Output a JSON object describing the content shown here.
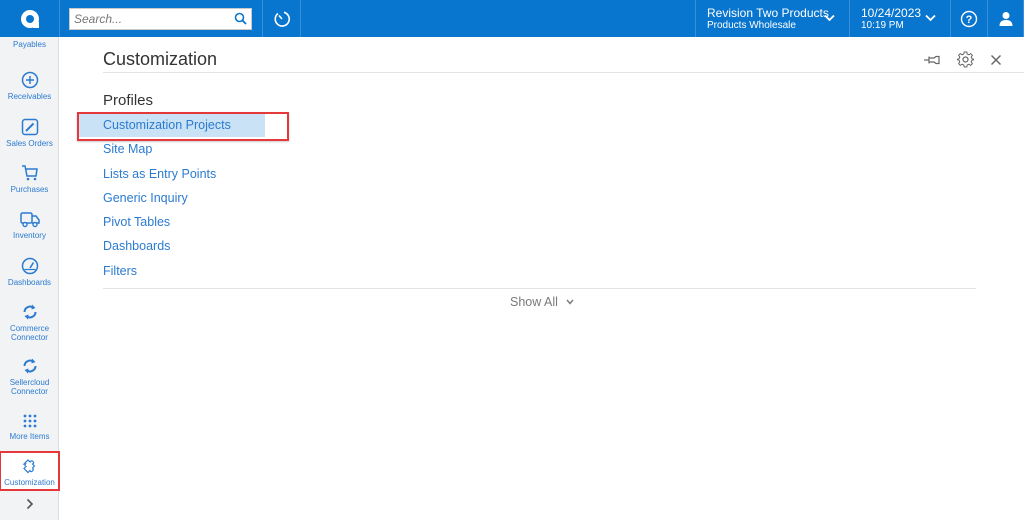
{
  "topbar": {
    "search_placeholder": "Search...",
    "tenant": {
      "name": "Revision Two Products",
      "branch": "Products Wholesale"
    },
    "date": {
      "date": "10/24/2023",
      "time": "10:19 PM"
    }
  },
  "sidebar": {
    "items": [
      {
        "label": "Payables",
        "icon": "payables-icon"
      },
      {
        "label": "Receivables",
        "icon": "plus-circle-icon"
      },
      {
        "label": "Sales Orders",
        "icon": "edit-icon"
      },
      {
        "label": "Purchases",
        "icon": "cart-icon"
      },
      {
        "label": "Inventory",
        "icon": "truck-icon"
      },
      {
        "label": "Dashboards",
        "icon": "gauge-icon"
      },
      {
        "label": "Commerce Connector",
        "label_l1": "Commerce",
        "label_l2": "Connector",
        "icon": "sync-icon"
      },
      {
        "label": "Sellercloud Connector",
        "label_l1": "Sellercloud",
        "label_l2": "Connector",
        "icon": "sync-icon"
      },
      {
        "label": "More Items",
        "icon": "grid-icon"
      },
      {
        "label": "Customization",
        "icon": "puzzle-icon",
        "active": true
      }
    ]
  },
  "main": {
    "title": "Customization",
    "section": "Profiles",
    "links": [
      "Customization Projects",
      "Site Map",
      "Lists as Entry Points",
      "Generic Inquiry",
      "Pivot Tables",
      "Dashboards",
      "Filters"
    ],
    "selected_link": "Customization Projects",
    "show_all": "Show All"
  },
  "colors": {
    "brand": "#0875cf",
    "link": "#2b7bd1",
    "highlight_border": "#e5383b",
    "selection_bg": "#c9e2f5"
  }
}
